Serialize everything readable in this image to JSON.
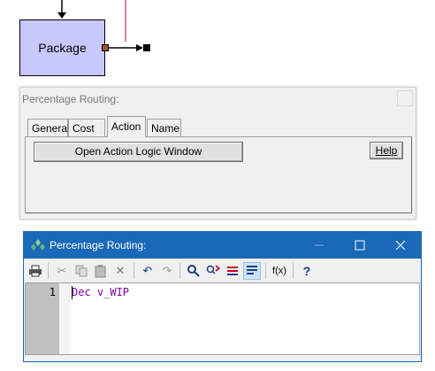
{
  "diagram": {
    "package_label": "Package"
  },
  "dialog1": {
    "title": "Percentage Routing:",
    "tabs": [
      "General",
      "Cost",
      "Action",
      "Name"
    ],
    "active_tab": "Action",
    "open_button_label": "Open Action Logic Window",
    "help_button_label": "Help"
  },
  "dialog2": {
    "title": "Percentage Routing:",
    "toolbar_icons": [
      "print-icon",
      "cut-icon",
      "copy-icon",
      "paste-icon",
      "delete-icon",
      "undo-icon",
      "redo-icon",
      "find-icon",
      "replace-icon",
      "bookmark-icon",
      "word-wrap-icon",
      "function-icon",
      "help-icon"
    ],
    "editor": {
      "line_number": "1",
      "code": "Dec v_WIP"
    },
    "function_label": "f(x)",
    "help_label": "?"
  },
  "colors": {
    "package_fill": "#c8c8ff",
    "titlebar_blue": "#1a68b8",
    "code_purple": "#7a00a0",
    "connector_red": "#c0001f"
  }
}
